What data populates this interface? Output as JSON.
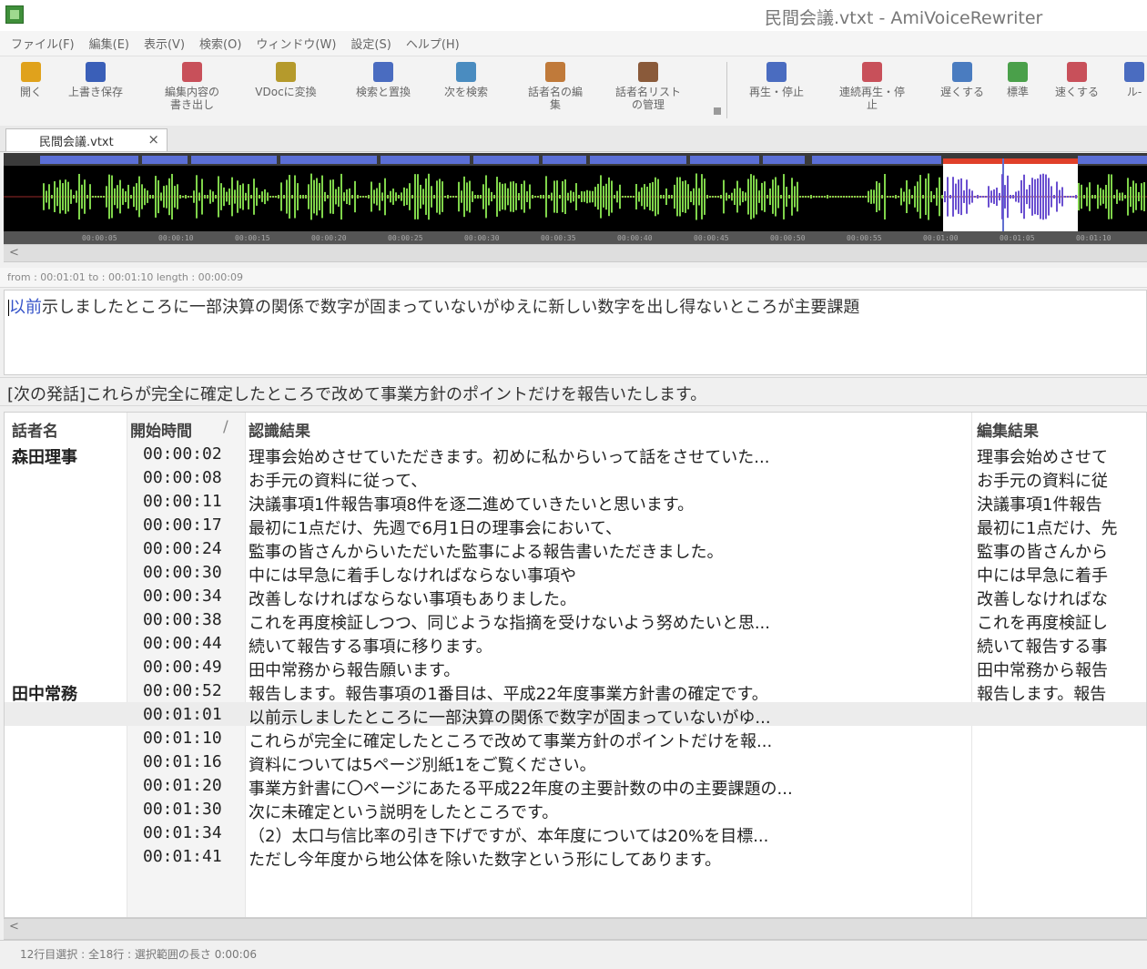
{
  "window": {
    "title": "民間会議.vtxt - AmiVoiceRewriter"
  },
  "menu": [
    "ファイル(F)",
    "編集(E)",
    "表示(V)",
    "検索(O)",
    "ウィンドウ(W)",
    "設定(S)",
    "ヘルプ(H)"
  ],
  "toolbar": {
    "buttons": [
      {
        "id": "open",
        "label1": "開く",
        "label2": "",
        "icon": "folder-icon",
        "color": "#e0a21c"
      },
      {
        "id": "save",
        "label1": "上書き保存",
        "label2": "",
        "icon": "save-icon",
        "color": "#3a5fb8"
      },
      {
        "id": "export",
        "label1": "編集内容の",
        "label2": "書き出し",
        "icon": "export-icon",
        "color": "#c8505a"
      },
      {
        "id": "convert",
        "label1": "VDocに変換",
        "label2": "",
        "icon": "convert-icon",
        "color": "#b59a2c"
      },
      {
        "id": "findreplace",
        "label1": "検索と置換",
        "label2": "",
        "icon": "binoculars-icon",
        "color": "#4a6cc0"
      },
      {
        "id": "findnext",
        "label1": "次を検索",
        "label2": "",
        "icon": "binoculars-next-icon",
        "color": "#4a8cc0"
      },
      {
        "id": "speaker",
        "label1": "話者名の編",
        "label2": "集",
        "icon": "speaker-icon",
        "color": "#c07a3a"
      },
      {
        "id": "speakerlist",
        "label1": "話者名リスト",
        "label2": "の管理",
        "icon": "speaker-list-icon",
        "color": "#8a5a3a"
      },
      {
        "id": "play",
        "label1": "再生・停止",
        "label2": "",
        "icon": "play-stop-icon",
        "color": "#4a6cc0"
      },
      {
        "id": "contplay",
        "label1": "連続再生・停",
        "label2": "止",
        "icon": "continuous-play-icon",
        "color": "#c8505a"
      },
      {
        "id": "slow",
        "label1": "遅くする",
        "label2": "",
        "icon": "slow-icon",
        "color": "#4a7cc0"
      },
      {
        "id": "normal",
        "label1": "標準",
        "label2": "",
        "icon": "normal-speed-icon",
        "color": "#4aa04a"
      },
      {
        "id": "fast",
        "label1": "速くする",
        "label2": "",
        "icon": "fast-icon",
        "color": "#c8505a"
      },
      {
        "id": "loop",
        "label1": "ル-",
        "label2": "",
        "icon": "loop-icon",
        "color": "#4a6cc0"
      }
    ]
  },
  "tab": {
    "label": "民間会議.vtxt",
    "close": "×"
  },
  "waveform": {
    "timestamps": [
      "00:00:05",
      "00:00:10",
      "00:00:15",
      "00:00:20",
      "00:00:25",
      "00:00:30",
      "00:00:35",
      "00:00:40",
      "00:00:45",
      "00:00:50",
      "00:00:55",
      "00:01:00",
      "00:01:05",
      "00:01:10"
    ]
  },
  "range": {
    "text": "from : 00:01:01  to : 00:01:10  length : 00:00:09"
  },
  "editor": {
    "highlight": "以前",
    "rest": "示しましたところに一部決算の関係で数字が固まっていないがゆえに新しい数字を出し得ないところが主要課題"
  },
  "next_utterance": "[次の発話]これらが完全に確定したところで改めて事業方針のポイントだけを報告いたします。",
  "table": {
    "headers": {
      "speaker": "話者名",
      "time": "開始時間",
      "time_sort": "/",
      "recognition": "認識結果",
      "edit": "編集結果"
    },
    "rows": [
      {
        "speaker": "森田理事",
        "time": "00:00:02",
        "rec": "理事会始めさせていただきます。初めに私からいって話をさせていた...",
        "edit": "理事会始めさせて"
      },
      {
        "speaker": "",
        "time": "00:00:08",
        "rec": "お手元の資料に従って、",
        "edit": "お手元の資料に従"
      },
      {
        "speaker": "",
        "time": "00:00:11",
        "rec": "決議事項1件報告事項8件を逐二進めていきたいと思います。",
        "edit": "決議事項1件報告"
      },
      {
        "speaker": "",
        "time": "00:00:17",
        "rec": "最初に1点だけ、先週で6月1日の理事会において、",
        "edit": "最初に1点だけ、先"
      },
      {
        "speaker": "",
        "time": "00:00:24",
        "rec": "監事の皆さんからいただいた監事による報告書いただきました。",
        "edit": "監事の皆さんから"
      },
      {
        "speaker": "",
        "time": "00:00:30",
        "rec": "中には早急に着手しなければならない事項や",
        "edit": "中には早急に着手"
      },
      {
        "speaker": "",
        "time": "00:00:34",
        "rec": "改善しなければならない事項もありました。",
        "edit": "改善しなければな"
      },
      {
        "speaker": "",
        "time": "00:00:38",
        "rec": "これを再度検証しつつ、同じような指摘を受けないよう努めたいと思...",
        "edit": "これを再度検証し"
      },
      {
        "speaker": "",
        "time": "00:00:44",
        "rec": "続いて報告する事項に移ります。",
        "edit": "続いて報告する事"
      },
      {
        "speaker": "",
        "time": "00:00:49",
        "rec": "田中常務から報告願います。",
        "edit": "田中常務から報告"
      },
      {
        "speaker": "田中常務",
        "time": "00:00:52",
        "rec": "報告します。報告事項の1番目は、平成22年度事業方針書の確定です。",
        "edit": "報告します。報告"
      },
      {
        "speaker": "",
        "time": "00:01:01",
        "rec": "以前示しましたところに一部決算の関係で数字が固まっていないがゆ...",
        "edit": "",
        "selected": true
      },
      {
        "speaker": "",
        "time": "00:01:10",
        "rec": "これらが完全に確定したところで改めて事業方針のポイントだけを報...",
        "edit": ""
      },
      {
        "speaker": "",
        "time": "00:01:16",
        "rec": "資料については5ページ別紙1をご覧ください。",
        "edit": ""
      },
      {
        "speaker": "",
        "time": "00:01:20",
        "rec": "事業方針書に〇ページにあたる平成22年度の主要計数の中の主要課題の...",
        "edit": ""
      },
      {
        "speaker": "",
        "time": "00:01:30",
        "rec": "次に未確定という説明をしたところです。",
        "edit": ""
      },
      {
        "speaker": "",
        "time": "00:01:34",
        "rec": "（2）太口与信比率の引き下げですが、本年度については20%を目標...",
        "edit": ""
      },
      {
        "speaker": "",
        "time": "00:01:41",
        "rec": "ただし今年度から地公体を除いた数字という形にしてあります。",
        "edit": ""
      }
    ]
  },
  "status": {
    "text": "12行目選択 : 全18行 : 選択範囲の長さ 0:00:06"
  }
}
